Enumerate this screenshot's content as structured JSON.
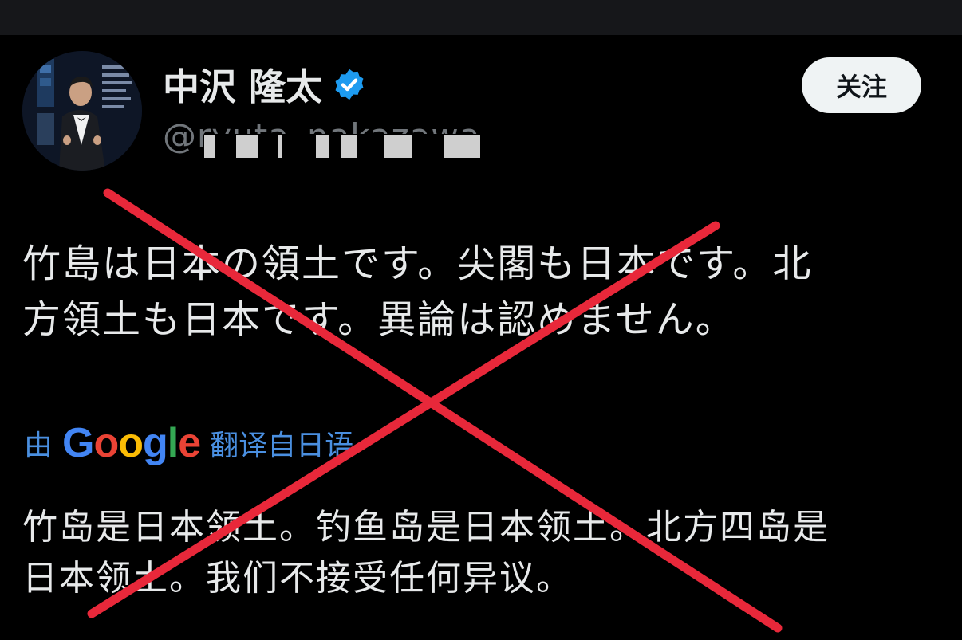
{
  "user": {
    "display_name": "中沢 隆太",
    "handle": "@ryuta_nakazawa"
  },
  "follow_button": {
    "label": "关注"
  },
  "tweet": {
    "original_line1": "竹島は日本の領土です。尖閣も日本です。北",
    "original_line2": "方領土も日本です。異論は認めません。",
    "translated_line1": "竹岛是日本领土。钓鱼岛是日本领土。北方四岛是",
    "translated_line2": "日本领土。我们不接受任何异议。"
  },
  "translation": {
    "prefix": "由",
    "brand": {
      "letters": [
        "G",
        "o",
        "o",
        "g",
        "l",
        "e"
      ],
      "colors": [
        "#4285f4",
        "#ea4335",
        "#fbbc05",
        "#4285f4",
        "#34a853",
        "#ea4335"
      ]
    },
    "suffix": "翻译自日语"
  },
  "colors": {
    "background": "#000000",
    "verified_badge": "#1d9bf0",
    "cross_mark": "#e8283a"
  }
}
